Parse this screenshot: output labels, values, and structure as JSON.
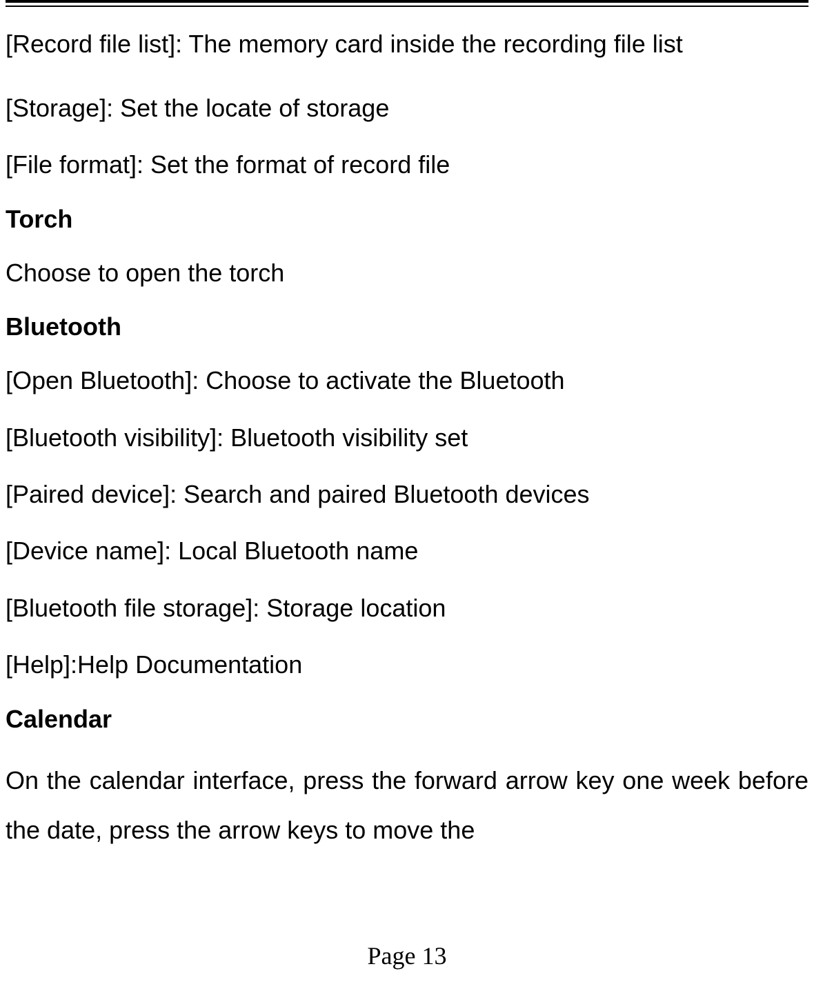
{
  "paragraphs": {
    "p1": "[Record file list]: The memory card inside the recording file list",
    "p2": "[Storage]: Set the locate of storage",
    "p3": "[File format]: Set the format of record file",
    "h1": "Torch",
    "p4": "Choose to open the torch",
    "h2": "Bluetooth",
    "p5": "[Open Bluetooth]: Choose to activate the Bluetooth",
    "p6": "[Bluetooth visibility]: Bluetooth visibility set",
    "p7": "[Paired device]: Search and paired Bluetooth devices",
    "p8": "[Device name]: Local Bluetooth name",
    "p9": "[Bluetooth file storage]: Storage location",
    "p10": "[Help]:Help Documentation",
    "h3": "Calendar",
    "p11": "On the calendar interface, press the forward arrow key one week before the date, press the arrow keys to move the"
  },
  "footer": {
    "page_number": "Page 13"
  }
}
